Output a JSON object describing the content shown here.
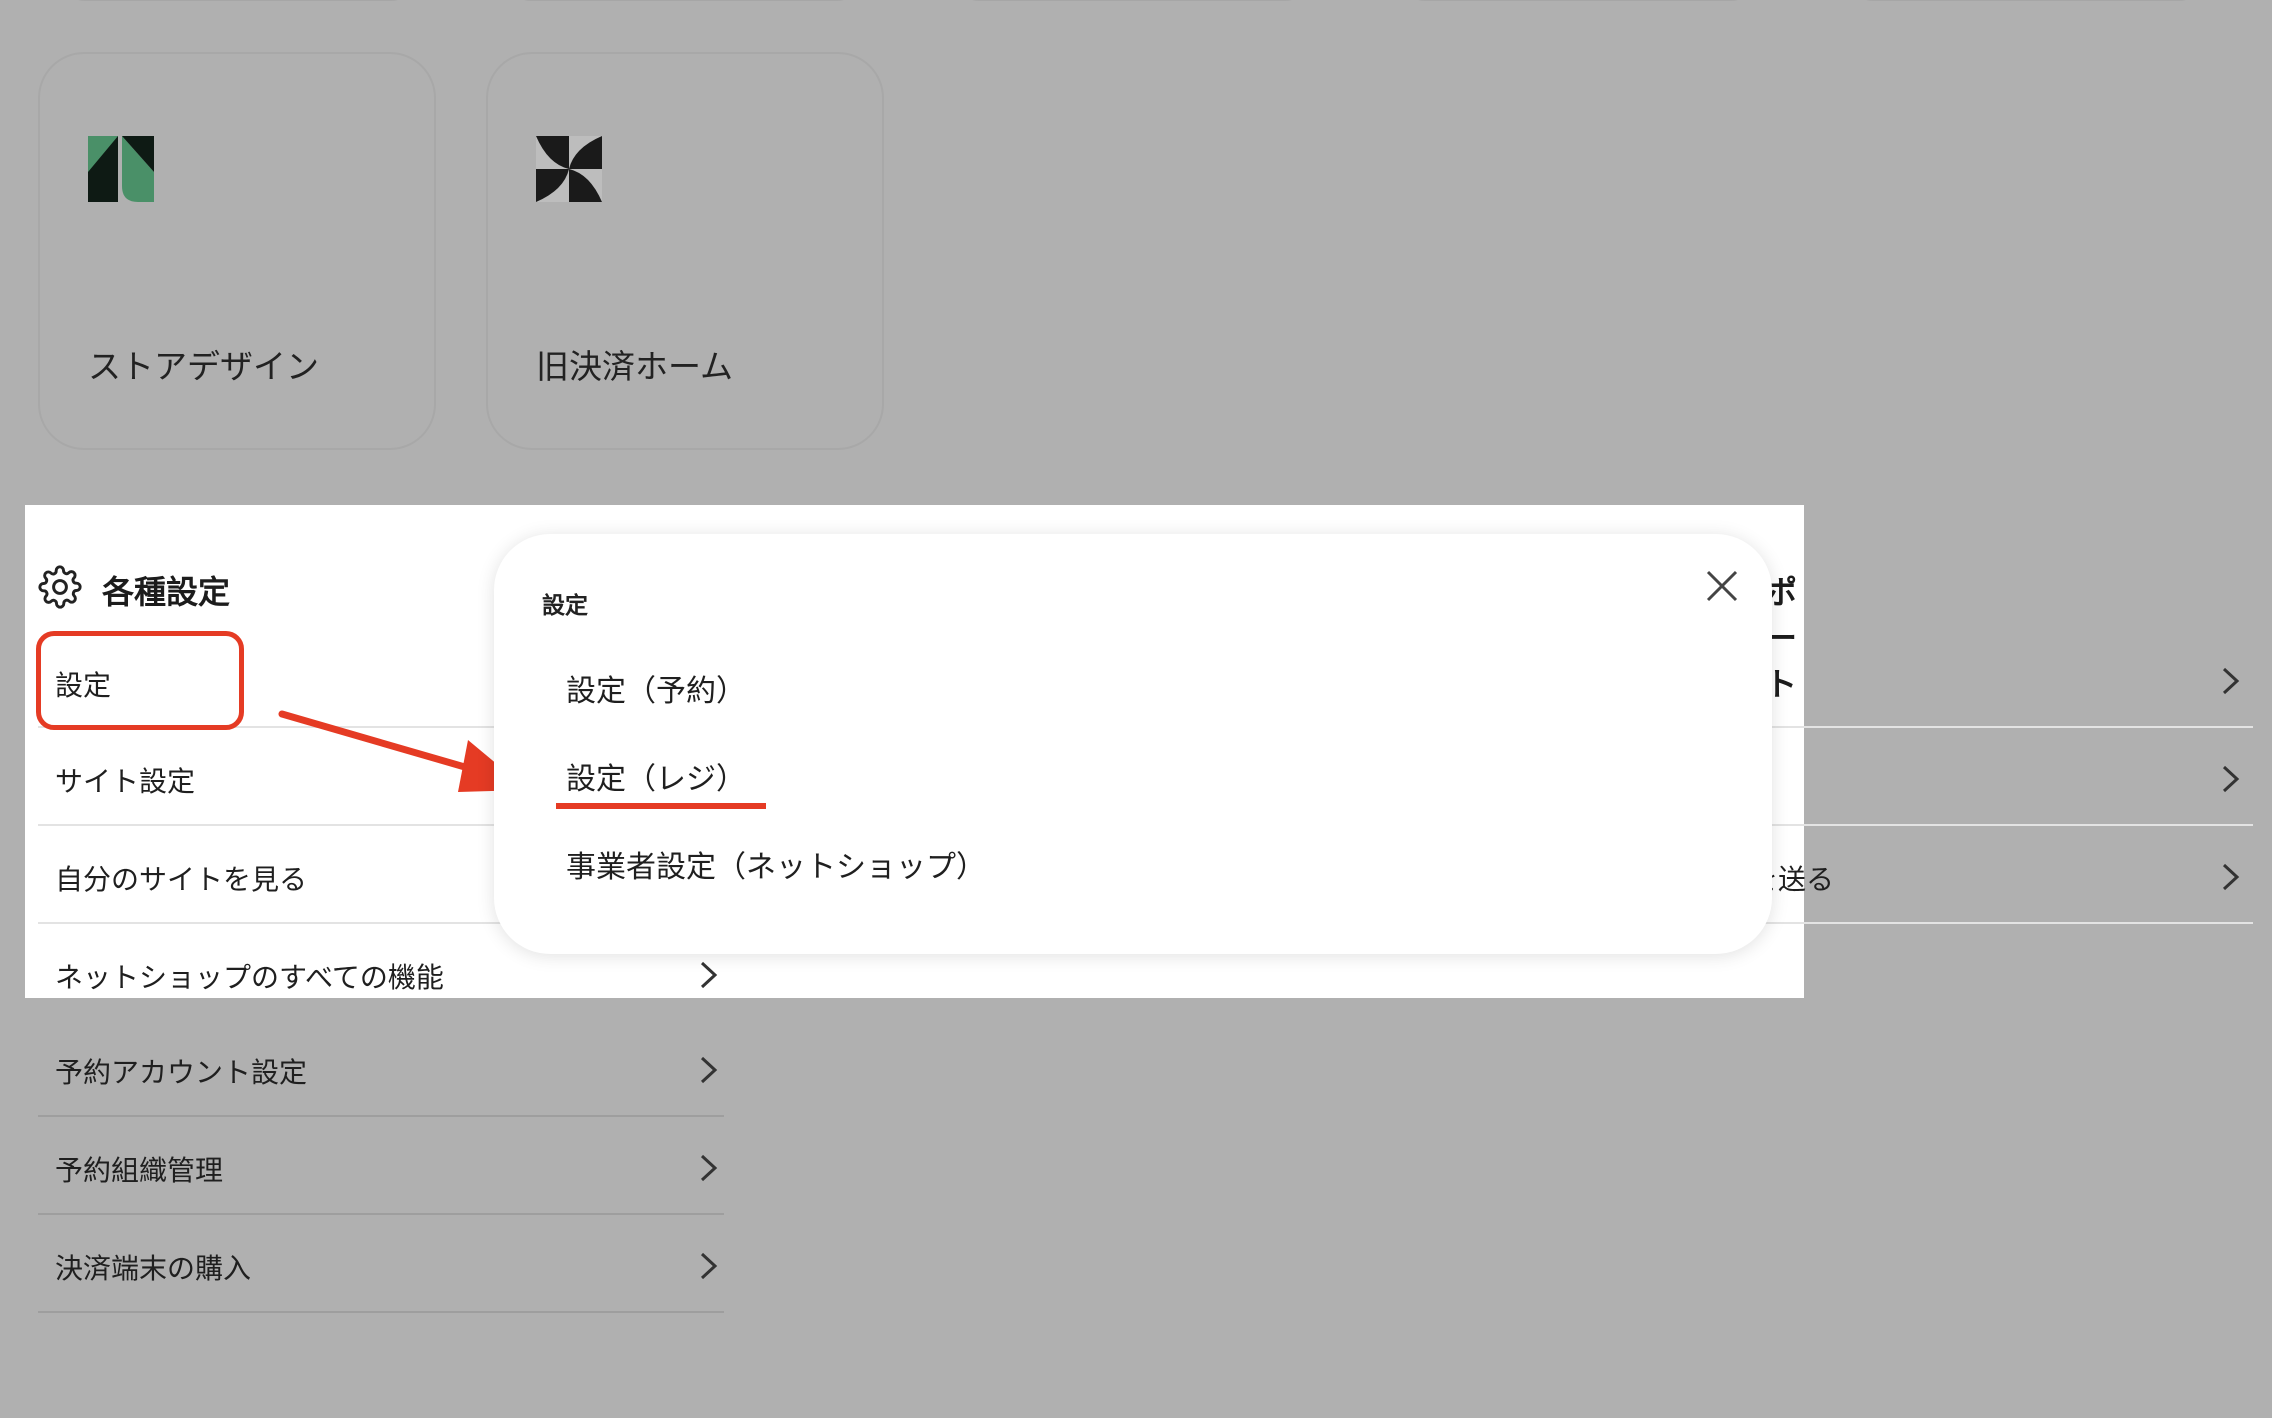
{
  "apps": [
    {
      "label": "ストアデザイン",
      "icon": "store-design-logo-icon",
      "color": "#4a9068"
    },
    {
      "label": "旧決済ホーム",
      "icon": "pinwheel-logo-icon",
      "color": "#1a1a1a"
    }
  ],
  "settings": {
    "title": "各種設定",
    "icon": "gear-icon",
    "items": [
      {
        "label": "設定"
      },
      {
        "label": "サイト設定"
      },
      {
        "label": "自分のサイトを見る"
      },
      {
        "label": "ネットショップのすべての機能"
      },
      {
        "label": "予約アカウント設定"
      },
      {
        "label": "予約組織管理"
      },
      {
        "label": "決済端末の購入"
      }
    ]
  },
  "support": {
    "title_fragment": "ポート",
    "items": [
      {
        "label": ""
      },
      {
        "label": ""
      },
      {
        "label": "を送る"
      }
    ]
  },
  "modal": {
    "heading": "設定",
    "close_icon": "close-icon",
    "options": [
      {
        "label": "設定（予約）"
      },
      {
        "label": "設定（レジ）"
      },
      {
        "label": "事業者設定（ネットショップ）"
      }
    ]
  },
  "annotation_color": "#e53b24"
}
